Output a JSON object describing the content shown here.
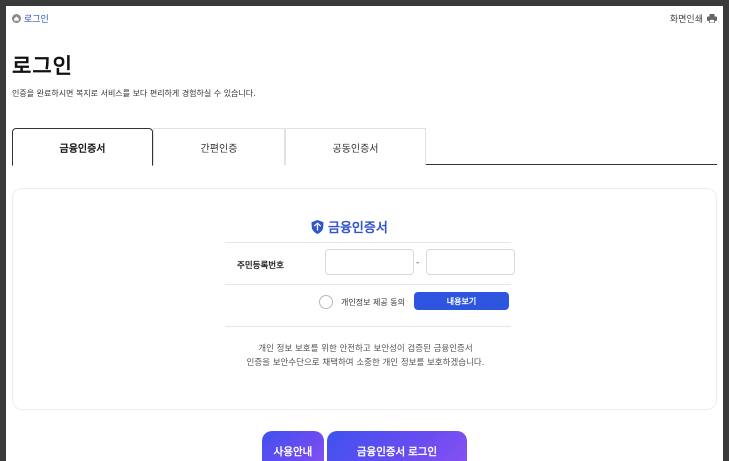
{
  "topbar": {
    "breadcrumb_label": "로그인",
    "print_label": "화면인쇄"
  },
  "page": {
    "title": "로그인",
    "description": "인증을 완료하시면 복지로 서비스를 보다 편리하게 경험하실 수 있습니다."
  },
  "tabs": [
    {
      "label": "금융인증서",
      "active": true
    },
    {
      "label": "간편인증",
      "active": false
    },
    {
      "label": "공동인증서",
      "active": false
    }
  ],
  "cert_panel": {
    "title": "금융인증서",
    "rrn_label": "주민등록번호",
    "rrn_front_value": "",
    "rrn_back_value": "",
    "rrn_separator": "-",
    "agree_label": "개인정보 제공 동의",
    "agree_checked": false,
    "view_button_label": "내용보기",
    "notice_line1": "개인 정보 보호를 위한 안전하고 보안성이 검증된 금융인증서",
    "notice_line2": "인증을 보안수단으로 채택하여 소중한 개인 정보를 보호하겠습니다."
  },
  "actions": {
    "guide_button_label": "사용안내",
    "login_button_label": "금융인증서 로그인"
  },
  "colors": {
    "accent_blue": "#2f55c9",
    "button_blue": "#2e55e0",
    "gradient_start": "#3e52ef",
    "gradient_end": "#8a52f2"
  },
  "icons": [
    "home-icon",
    "print-icon",
    "shield-icon"
  ]
}
